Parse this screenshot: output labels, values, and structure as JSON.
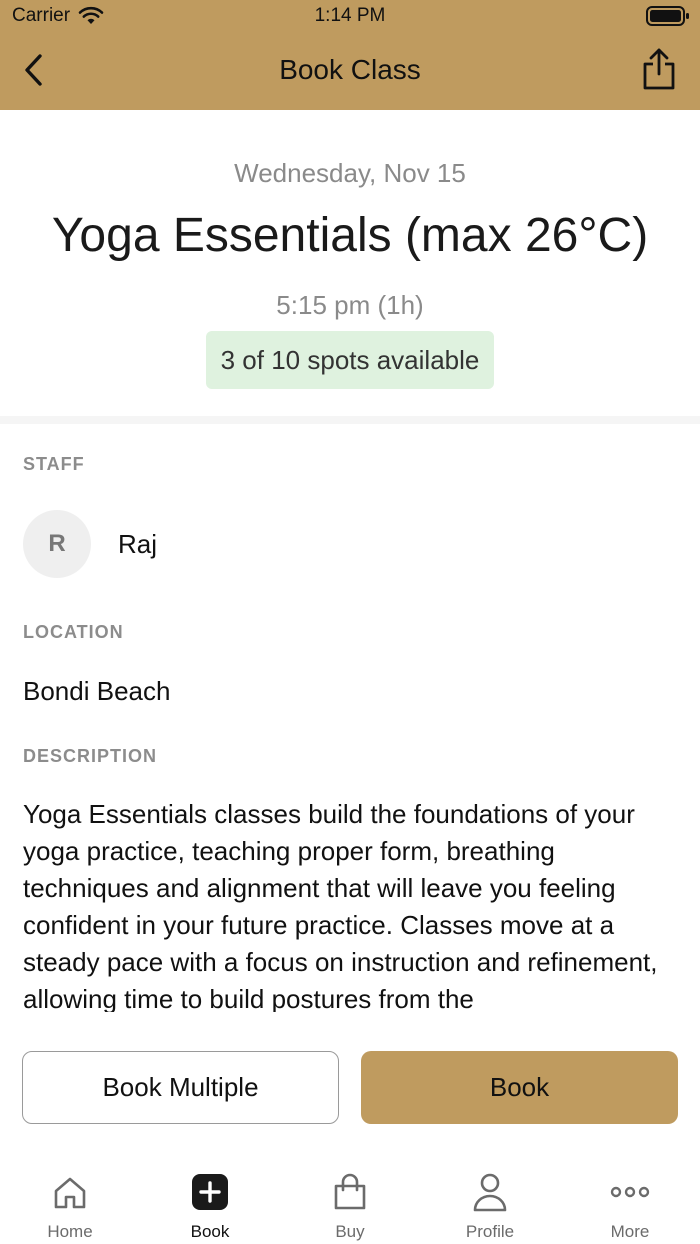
{
  "status_bar": {
    "carrier": "Carrier",
    "time": "1:14 PM"
  },
  "nav": {
    "title": "Book Class",
    "back_icon": "chevron-left-icon",
    "share_icon": "share-icon"
  },
  "class": {
    "date": "Wednesday, Nov 15",
    "name": "Yoga Essentials (max 26°C)",
    "time": "5:15 pm (1h)",
    "spots": "3 of 10 spots available"
  },
  "staff": {
    "label": "STAFF",
    "initial": "R",
    "name": "Raj"
  },
  "location": {
    "label": "LOCATION",
    "name": "Bondi Beach"
  },
  "description": {
    "label": "DESCRIPTION",
    "text": "Yoga Essentials classes build the foundations of your yoga practice, teaching proper form, breathing techniques and alignment that will leave you feeling confident in your future practice. Classes move at a steady pace with a focus on instruction and refinement, allowing time to build postures from the"
  },
  "actions": {
    "book_multiple": "Book Multiple",
    "book": "Book"
  },
  "tabs": [
    {
      "label": "Home",
      "icon": "home-icon"
    },
    {
      "label": "Book",
      "icon": "plus-square-icon"
    },
    {
      "label": "Buy",
      "icon": "shopping-bag-icon"
    },
    {
      "label": "Profile",
      "icon": "person-icon"
    },
    {
      "label": "More",
      "icon": "more-dots-icon"
    }
  ],
  "colors": {
    "brand": "#bf9b5f",
    "badge_bg": "#dff2df"
  }
}
